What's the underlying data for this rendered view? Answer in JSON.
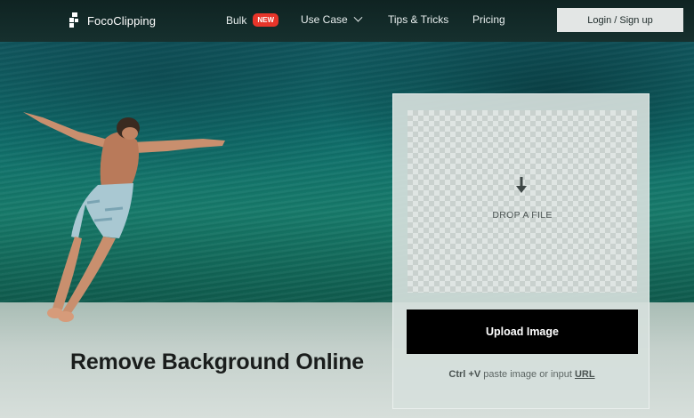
{
  "brand": {
    "name": "FocoClipping"
  },
  "nav": {
    "bulk": "Bulk",
    "bulk_badge": "NEW",
    "use_case": "Use Case",
    "tips": "Tips & Tricks",
    "pricing": "Pricing",
    "login": "Login / Sign up"
  },
  "hero": {
    "headline": "Remove Background Online"
  },
  "upload": {
    "drop_text": "DROP A FILE",
    "button": "Upload Image",
    "shortcut": "Ctrl +V",
    "paste_text": " paste image or input ",
    "url_link": "URL"
  },
  "colors": {
    "badge_red": "#e8352a",
    "upload_button": "#000000",
    "nav_bg": "#0f2322"
  },
  "icons": [
    "logo-icon",
    "chevron-down-icon",
    "download-arrow-icon"
  ]
}
